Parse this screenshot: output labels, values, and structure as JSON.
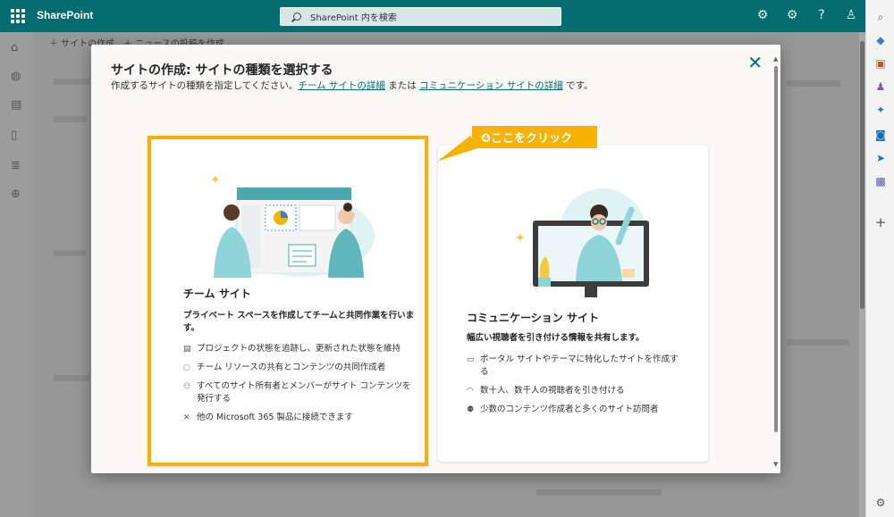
{
  "app": {
    "brand": "SharePoint",
    "search_placeholder": "SharePoint 内を検索"
  },
  "command_bar": {
    "text": "＋ サイトの作成　＋ ニュースの投稿を作成"
  },
  "dialog": {
    "title": "サイトの作成: サイトの種類を選択する",
    "subtitle_prefix": "作成するサイトの種類を指定してください。",
    "link_team": "チーム サイトの詳細",
    "subtitle_mid": " または ",
    "link_comm": "コミュニケーション サイトの詳細",
    "subtitle_suffix": " です。"
  },
  "callout": {
    "label": "❹ここをクリック"
  },
  "team_card": {
    "title": "チーム サイト",
    "lead": "プライベート スペースを作成してチームと共同作業を行います。",
    "features": [
      {
        "icon": "clipboard-icon",
        "text": "プロジェクトの状態を追跡し、更新された状態を維持"
      },
      {
        "icon": "sync-icon",
        "text": "チーム リソースの共有とコンテンツの共同作成者"
      },
      {
        "icon": "people-icon",
        "text": "すべてのサイト所有者とメンバーがサイト コンテンツを発行する"
      },
      {
        "icon": "connect-icon",
        "text": "他の Microsoft 365 製品に接続できます"
      }
    ]
  },
  "comm_card": {
    "title": "コミュニケーション サイト",
    "lead": "幅広い視聴者を引き付ける情報を共有します。",
    "features": [
      {
        "icon": "page-icon",
        "text": "ポータル サイトやテーマに特化したサイトを作成する"
      },
      {
        "icon": "broadcast-icon",
        "text": "数十人、数千人の視聴者を引き付ける"
      },
      {
        "icon": "authors-icon",
        "text": "少数のコンテンツ作成者と多くのサイト訪問者"
      }
    ]
  },
  "colors": {
    "brand": "#036c70",
    "highlight": "#f5b300",
    "link": "#036c70"
  }
}
